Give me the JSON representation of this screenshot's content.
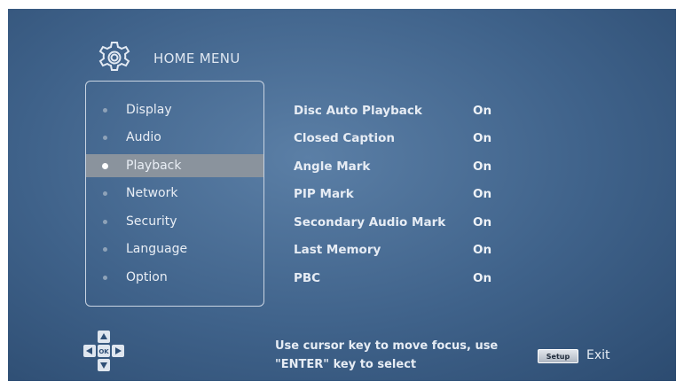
{
  "header": {
    "title": "HOME MENU",
    "icon": "gear-icon"
  },
  "menu": {
    "items": [
      {
        "label": "Display"
      },
      {
        "label": "Audio"
      },
      {
        "label": "Playback"
      },
      {
        "label": "Network"
      },
      {
        "label": "Security"
      },
      {
        "label": "Language"
      },
      {
        "label": "Option"
      }
    ],
    "selected": "Playback"
  },
  "settings": [
    {
      "label": "Disc Auto Playback",
      "value": "On"
    },
    {
      "label": "Closed Caption",
      "value": "On"
    },
    {
      "label": "Angle Mark",
      "value": "On"
    },
    {
      "label": "PIP Mark",
      "value": "On"
    },
    {
      "label": "Secondary Audio Mark",
      "value": "On"
    },
    {
      "label": "Last Memory",
      "value": "On"
    },
    {
      "label": "PBC",
      "value": "On"
    }
  ],
  "footer": {
    "help_line1": "Use cursor key to move focus, use",
    "help_line2": "\"ENTER\" key to select",
    "dpad_center": "OK",
    "setup_key": "Setup",
    "exit_label": "Exit"
  },
  "colors": {
    "background": "#3f628a",
    "highlight": "#8a939d",
    "text": "#e6ecf4"
  }
}
